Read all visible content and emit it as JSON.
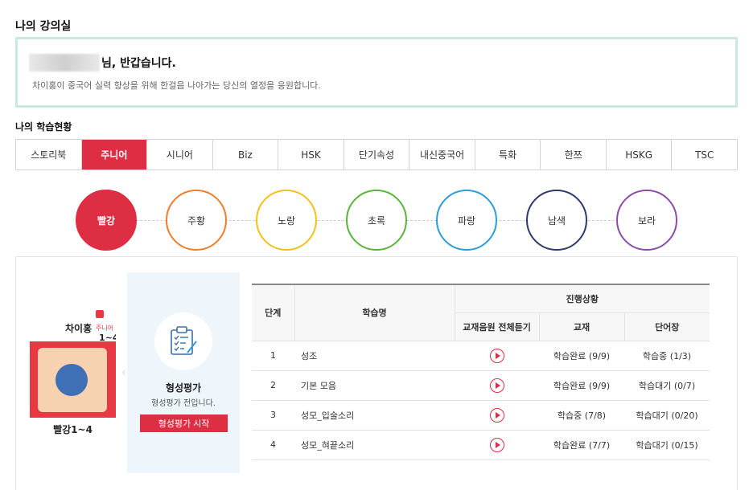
{
  "page": {
    "title": "나의 강의실",
    "greeting_suffix": "님, 반갑습니다.",
    "welcome_message": "차이홍이 중국어 실력 향상을 위해 한걸음 나아가는 당신의 열정을 응원합니다.",
    "section_title": "나의 학습현황"
  },
  "course_tabs": [
    {
      "label": "스토리북"
    },
    {
      "label": "주니어"
    },
    {
      "label": "시니어"
    },
    {
      "label": "Biz"
    },
    {
      "label": "HSK"
    },
    {
      "label": "단기속성"
    },
    {
      "label": "내신중국어"
    },
    {
      "label": "특화"
    },
    {
      "label": "한쯔"
    },
    {
      "label": "HSKG"
    },
    {
      "label": "TSC"
    }
  ],
  "active_tab": "주니어",
  "levels": [
    {
      "label": "빨강",
      "color": "#dd2e44"
    },
    {
      "label": "주황",
      "color": "#f07d2e"
    },
    {
      "label": "노랑",
      "color": "#f2c21b"
    },
    {
      "label": "초록",
      "color": "#5bb33a"
    },
    {
      "label": "파랑",
      "color": "#2f9bd8"
    },
    {
      "label": "남색",
      "color": "#2d3a6b"
    },
    {
      "label": "보라",
      "color": "#8a4ea6"
    }
  ],
  "book": {
    "title": "차이홍",
    "subtitle": "주니어",
    "range": "1~4",
    "label": "빨강1~4"
  },
  "evaluation": {
    "title": "형성평가",
    "subtitle": "형성평가 전입니다.",
    "button_label": "형성평가 시작"
  },
  "table": {
    "headers": {
      "step": "단계",
      "name": "학습명",
      "progress": "진행상황",
      "audio": "교재음원 전체듣기",
      "textbook": "교재",
      "vocab": "단어장"
    },
    "rows": [
      {
        "step": "1",
        "name": "성조",
        "textbook": "학습완료 (9/9)",
        "textbook_status": "done",
        "vocab": "학습중 (1/3)",
        "vocab_status": "prog"
      },
      {
        "step": "2",
        "name": "기본 모음",
        "textbook": "학습완료 (9/9)",
        "textbook_status": "done",
        "vocab": "학습대기 (0/7)",
        "vocab_status": "wait"
      },
      {
        "step": "3",
        "name": "성모_입술소리",
        "textbook": "학습중 (7/8)",
        "textbook_status": "prog",
        "vocab": "학습대기 (0/20)",
        "vocab_status": "wait"
      },
      {
        "step": "4",
        "name": "성모_혀끝소리",
        "textbook": "학습완료 (7/7)",
        "textbook_status": "done",
        "vocab": "학습대기 (0/15)",
        "vocab_status": "wait"
      }
    ]
  }
}
